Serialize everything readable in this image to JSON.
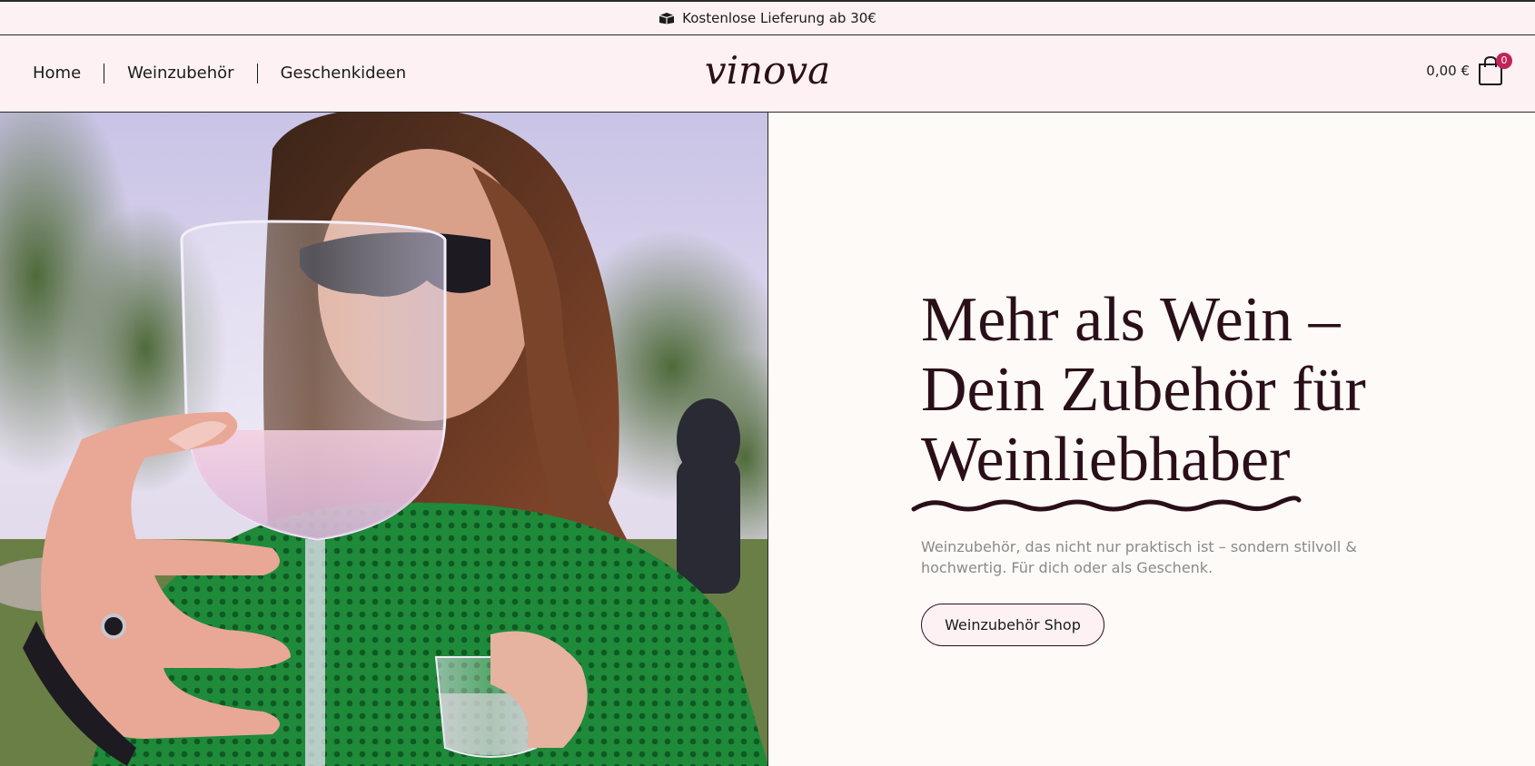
{
  "announcement": {
    "text": "Kostenlose Lieferung ab 30€",
    "icon": "box-icon"
  },
  "nav": {
    "items": [
      {
        "label": "Home"
      },
      {
        "label": "Weinzubehör"
      },
      {
        "label": "Geschenkideen"
      }
    ]
  },
  "logo": {
    "text": "vinova"
  },
  "cart": {
    "price": "0,00 €",
    "count": "0",
    "icon": "shopping-bag-icon"
  },
  "hero": {
    "title_lines": [
      "Mehr als Wein –",
      "Dein Zubehör für",
      "Weinliebhaber"
    ],
    "subtitle": "Weinzubehör, das nicht nur praktisch ist – sondern stilvoll & hochwertig. Für dich oder als Geschenk.",
    "cta_label": "Weinzubehör Shop",
    "image": "woman-holding-wine-glass-photo"
  },
  "colors": {
    "background": "#fdf1f3",
    "accent": "#2a0f19",
    "badge": "#c0245b",
    "content_bg": "#fdfaf8",
    "subtitle": "#8a8a8a"
  }
}
